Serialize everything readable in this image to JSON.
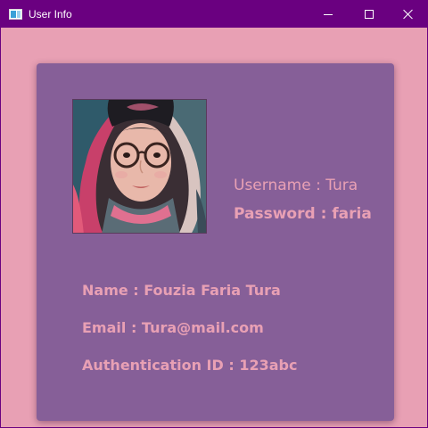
{
  "window": {
    "title": "User Info",
    "controls": {
      "minimize": "minimize",
      "maximize": "maximize",
      "close": "close"
    }
  },
  "colors": {
    "titlebar": "#6a0080",
    "background": "#e8a0b4",
    "card": "#865f98",
    "text": "#e8a0b4"
  },
  "profile": {
    "photo_icon": "user-photo",
    "username": "Username : Tura",
    "password": "Password : faria",
    "name": "Name : Fouzia Faria Tura",
    "email": "Email : Tura@mail.com",
    "auth_id": "Authentication ID : 123abc"
  }
}
